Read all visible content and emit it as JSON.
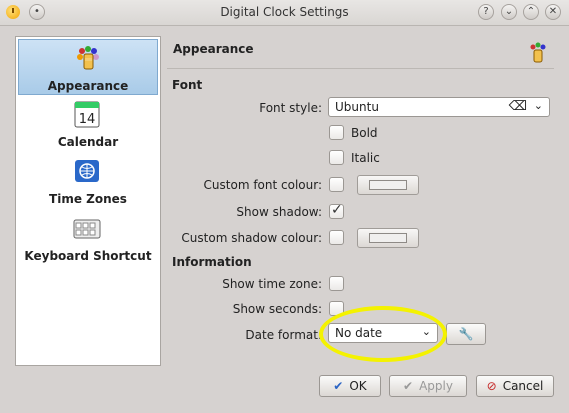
{
  "window": {
    "title": "Digital Clock Settings",
    "buttons": [
      "?",
      "⌄",
      "⌃",
      "✕"
    ]
  },
  "sidebar": {
    "items": [
      {
        "label": "Appearance",
        "icon": "appearance-icon",
        "selected": true
      },
      {
        "label": "Calendar",
        "icon": "calendar-icon",
        "day": "14"
      },
      {
        "label": "Time Zones",
        "icon": "globe-icon"
      },
      {
        "label": "Keyboard Shortcut",
        "icon": "keyboard-icon"
      }
    ]
  },
  "main": {
    "section_title": "Appearance",
    "font_group": {
      "title": "Font",
      "font_style_label": "Font style:",
      "font_style_value": "Ubuntu",
      "bold_label": "Bold",
      "bold_checked": false,
      "italic_label": "Italic",
      "italic_checked": false,
      "custom_font_colour_label": "Custom font colour:",
      "custom_font_colour_checked": false,
      "show_shadow_label": "Show shadow:",
      "show_shadow_checked": true,
      "custom_shadow_colour_label": "Custom shadow colour:",
      "custom_shadow_colour_checked": false
    },
    "information_group": {
      "title": "Information",
      "show_time_zone_label": "Show time zone:",
      "show_time_zone_checked": false,
      "show_seconds_label": "Show seconds:",
      "show_seconds_checked": false,
      "date_format_label": "Date format:",
      "date_format_value": "No date"
    }
  },
  "footer": {
    "ok_label": "OK",
    "apply_label": "Apply",
    "cancel_label": "Cancel"
  },
  "colors": {
    "accent": "#a9cbe8",
    "annotation": "#f4f200"
  }
}
